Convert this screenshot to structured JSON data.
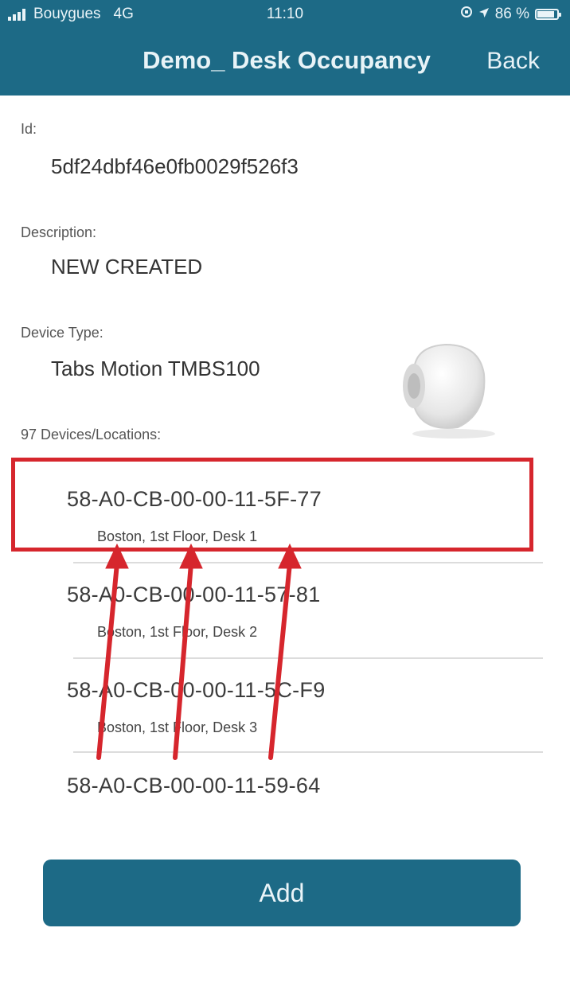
{
  "status_bar": {
    "carrier": "Bouygues",
    "network": "4G",
    "time": "11:10",
    "battery": "86 %"
  },
  "nav": {
    "title": "Demo_ Desk Occupancy",
    "back_label": "Back"
  },
  "fields": {
    "id_label": "Id:",
    "id_value": "5df24dbf46e0fb0029f526f3",
    "description_label": "Description:",
    "description_value": "NEW CREATED",
    "device_type_label": "Device Type:",
    "device_type_value": "Tabs Motion TMBS100",
    "devices_count_label": "97 Devices/Locations:"
  },
  "devices": [
    {
      "mac": "58-A0-CB-00-00-11-5F-77",
      "location": "Boston, 1st Floor, Desk 1"
    },
    {
      "mac": "58-A0-CB-00-00-11-57-81",
      "location": "Boston, 1st Floor, Desk 2"
    },
    {
      "mac": "58-A0-CB-00-00-11-5C-F9",
      "location": "Boston, 1st Floor, Desk 3"
    },
    {
      "mac": "58-A0-CB-00-00-11-59-64",
      "location": ""
    }
  ],
  "add_button_label": "Add",
  "colors": {
    "header": "#1d6a86",
    "highlight": "#d6262d",
    "arrow": "#d6262d"
  },
  "icons": {
    "signal": "signal-bars-icon",
    "location": "location-arrow-icon",
    "battery": "battery-icon",
    "sensor": "motion-sensor-image"
  }
}
